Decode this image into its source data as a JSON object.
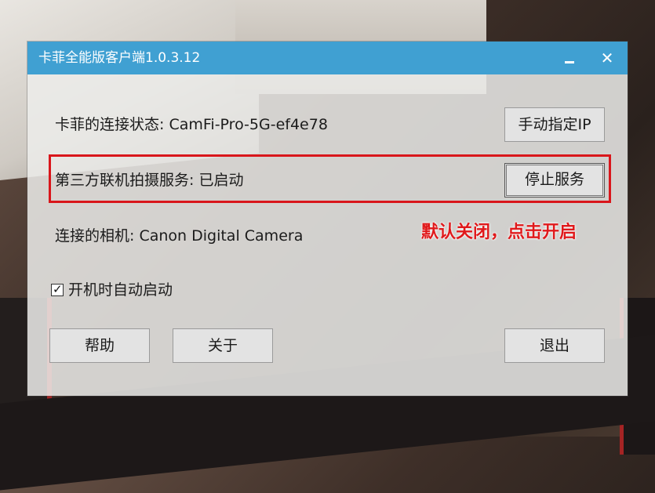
{
  "window": {
    "title": "卡菲全能版客户端1.0.3.12",
    "minimize_symbol": "",
    "close_symbol": "✕"
  },
  "connection": {
    "label": "卡菲的连接状态:",
    "value": "CamFi-Pro-5G-ef4e78",
    "manual_ip_button": "手动指定IP"
  },
  "service": {
    "label": "第三方联机拍摄服务:",
    "value": "已启动",
    "stop_button": "停止服务"
  },
  "camera": {
    "label": "连接的相机:",
    "value": "Canon Digital Camera"
  },
  "autostart": {
    "label": "开机时自动启动",
    "checked": true,
    "check_mark": "✓"
  },
  "buttons": {
    "help": "帮助",
    "about": "关于",
    "exit": "退出"
  },
  "annotation": {
    "text": "默认关闭，点击开启"
  },
  "colors": {
    "titlebar": "#40a0d2",
    "highlight": "#d9161b",
    "annotation": "#e0191b"
  }
}
